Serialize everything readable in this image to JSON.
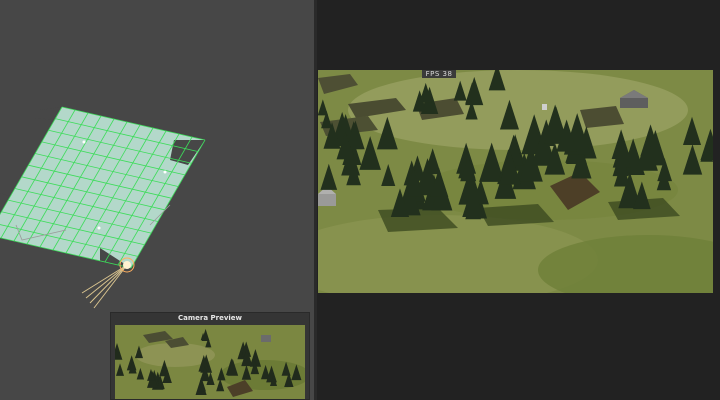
{
  "game_view": {
    "stats_label": "FPS 38"
  },
  "camera_preview": {
    "title": "Camera Preview"
  },
  "colors": {
    "scene_background": "#474747",
    "grid_line": "#3ddc5a",
    "terrain_tile": "#bfe8d8",
    "light_gizmo": "#ffd79a",
    "grass": "#7d8a45",
    "tree": "#24301f"
  },
  "icons": {
    "scene_light": "sun-light-icon",
    "camera_frustum": "camera-frustum-icon"
  }
}
